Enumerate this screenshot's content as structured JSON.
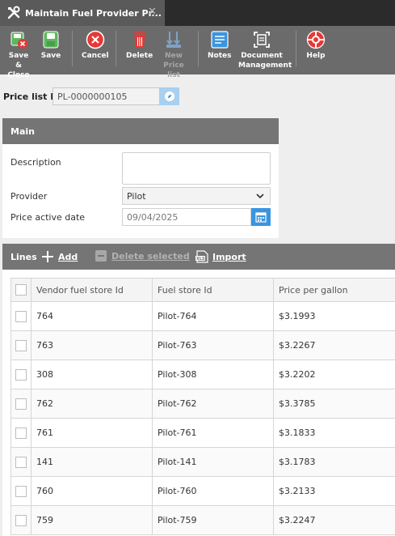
{
  "window": {
    "tab_title": "Maintain Fuel Provider Pr...",
    "tab_close": "✕"
  },
  "toolbar": {
    "save_close": "Save & Close",
    "save": "Save",
    "cancel": "Cancel",
    "delete": "Delete",
    "new_price_list": "New Price list",
    "notes": "Notes",
    "document_management": "Document Management",
    "help": "Help"
  },
  "price_list": {
    "label": "Price list Id",
    "value": "PL-0000000105"
  },
  "main": {
    "title": "Main",
    "description_label": "Description",
    "description_value": "",
    "provider_label": "Provider",
    "provider_value": "Pilot",
    "date_label": "Price active date",
    "date_value": "09/04/2025"
  },
  "lines": {
    "title": "Lines",
    "add": "Add",
    "delete_selected": "Delete selected",
    "import": "Import",
    "columns": [
      "Vendor fuel store Id",
      "Fuel store Id",
      "Price per gallon"
    ],
    "rows": [
      {
        "vendor_id": "764",
        "store_id": "Pilot-764",
        "price": "$3.1993"
      },
      {
        "vendor_id": "763",
        "store_id": "Pilot-763",
        "price": "$3.2267"
      },
      {
        "vendor_id": "308",
        "store_id": "Pilot-308",
        "price": "$3.2202"
      },
      {
        "vendor_id": "762",
        "store_id": "Pilot-762",
        "price": "$3.3785"
      },
      {
        "vendor_id": "761",
        "store_id": "Pilot-761",
        "price": "$3.1833"
      },
      {
        "vendor_id": "141",
        "store_id": "Pilot-141",
        "price": "$3.1783"
      },
      {
        "vendor_id": "760",
        "store_id": "Pilot-760",
        "price": "$3.2133"
      },
      {
        "vendor_id": "759",
        "store_id": "Pilot-759",
        "price": "$3.2247"
      }
    ]
  },
  "colors": {
    "titlebar": "#2b2b2b",
    "tab": "#5a5a5a",
    "toolbar": "#6b6b6b",
    "panel_header": "#757575",
    "accent_blue": "#3a95e0"
  }
}
